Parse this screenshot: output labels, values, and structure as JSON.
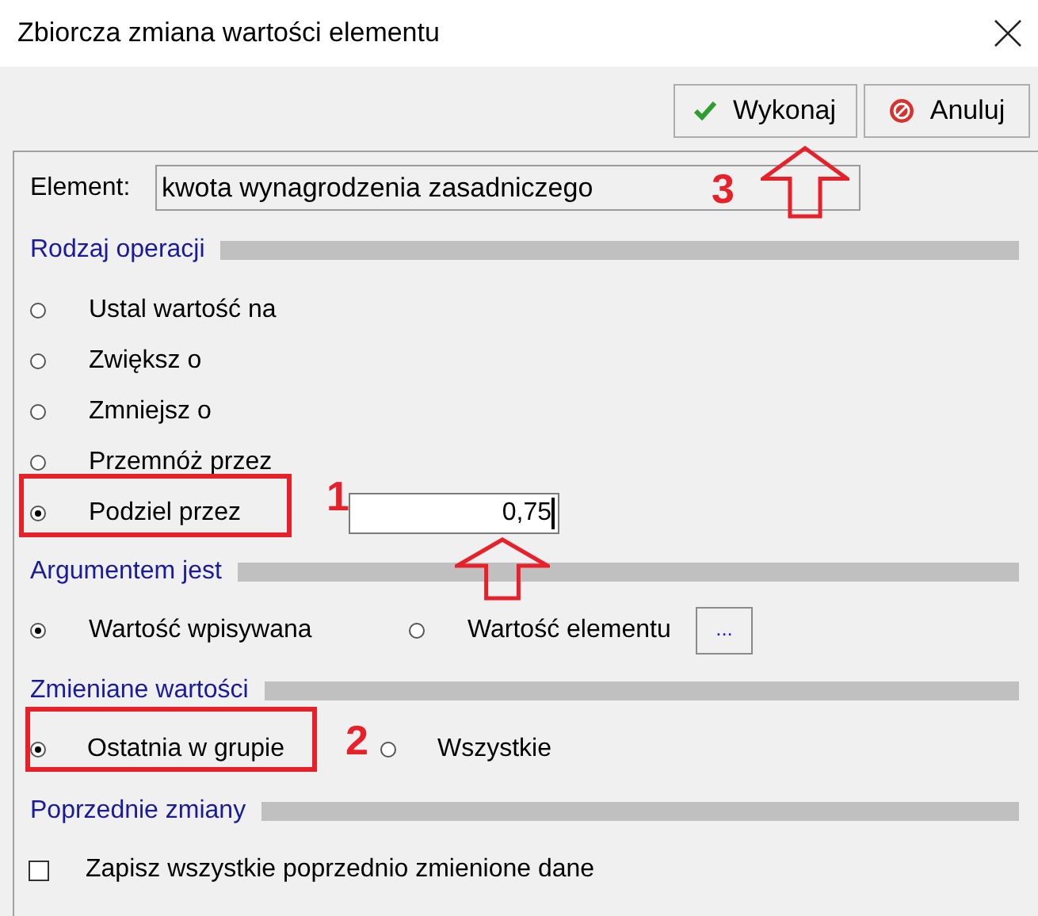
{
  "window": {
    "title": "Zbiorcza zmiana wartości elementu"
  },
  "buttons": [
    {
      "label": "Wykonaj",
      "kind": "ok"
    },
    {
      "label": "Anuluj",
      "kind": "cancel"
    }
  ],
  "element": {
    "label": "Element:",
    "value": "kwota wynagrodzenia zasadniczego"
  },
  "sections": [
    {
      "title": "Rodzaj operacji",
      "kind": "radio-list",
      "options": [
        {
          "label": "Ustal wartość na",
          "selected": false
        },
        {
          "label": "Zwiększ o",
          "selected": false
        },
        {
          "label": "Zmniejsz o",
          "selected": false
        },
        {
          "label": "Przemnóż przez",
          "selected": false
        },
        {
          "label": "Podziel przez",
          "selected": true,
          "field": {
            "value": "0,75"
          }
        }
      ]
    },
    {
      "title": "Argumentem jest",
      "kind": "radio-row",
      "options": [
        {
          "label": "Wartość wpisywana",
          "selected": true
        },
        {
          "label": "Wartość elementu",
          "selected": false
        }
      ],
      "browse_button": {
        "label": "..."
      }
    },
    {
      "title": "Zmieniane wartości",
      "kind": "radio-row",
      "options": [
        {
          "label": "Ostatnia w grupie",
          "selected": true
        },
        {
          "label": "Wszystkie",
          "selected": false
        }
      ]
    },
    {
      "title": "Poprzednie zmiany",
      "kind": "checkbox",
      "items": [
        {
          "label": "Zapisz wszystkie poprzednio zmienione dane",
          "checked": false
        }
      ]
    }
  ],
  "annotations": [
    {
      "label": "1"
    },
    {
      "label": "2"
    },
    {
      "label": "3"
    }
  ]
}
